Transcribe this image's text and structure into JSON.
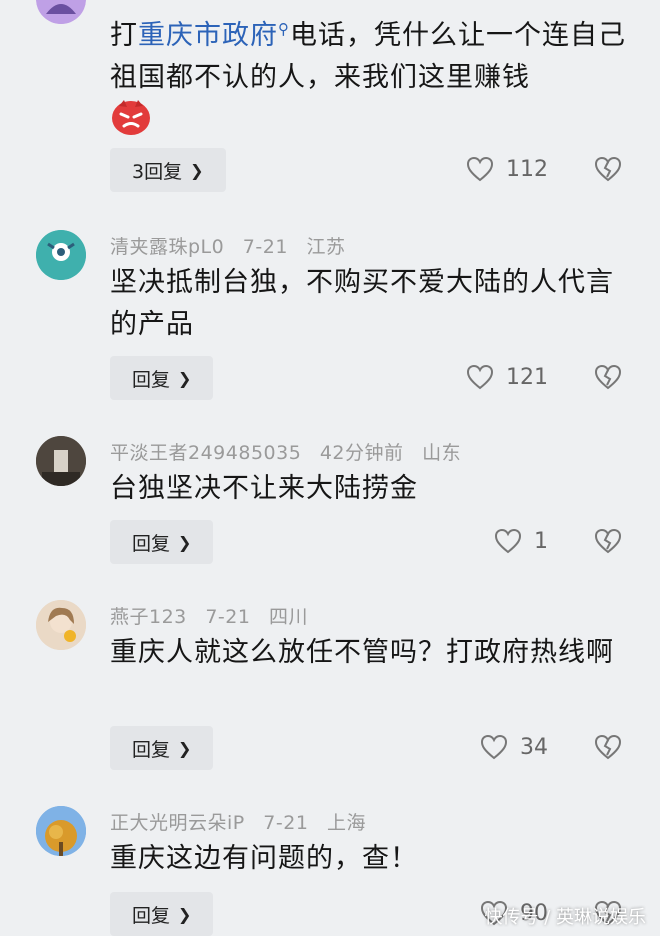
{
  "comments": [
    {
      "text_pre": "打",
      "text_link": "重庆市政府",
      "text_post": "电话，凭什么让一个连自己祖国都不认的人，来我们这里赚钱",
      "reply_label": "3回复",
      "likes": "112"
    },
    {
      "author": "清夹露珠pL0",
      "date": "7-21",
      "location": "江苏",
      "text": "坚决抵制台独，不购买不爱大陆的人代言的产品",
      "reply_label": "回复",
      "likes": "121"
    },
    {
      "author": "平淡王者249485035",
      "date": "42分钟前",
      "location": "山东",
      "text": "台独坚决不让来大陆捞金",
      "reply_label": "回复",
      "likes": "1"
    },
    {
      "author": "燕子123",
      "date": "7-21",
      "location": "四川",
      "text": "重庆人就这么放任不管吗？打政府热线啊",
      "reply_label": "回复",
      "likes": "34"
    },
    {
      "author": "正大光明云朵iP",
      "date": "7-21",
      "location": "上海",
      "text": "重庆这边有问题的，查！",
      "reply_label": "回复",
      "likes": "90"
    }
  ],
  "watermark": "快传号 / 英琳说娱乐",
  "icons": {
    "like": "heart-outline-icon",
    "dislike": "broken-heart-icon",
    "search": "search-icon",
    "chevron": "chevron-right-icon"
  }
}
